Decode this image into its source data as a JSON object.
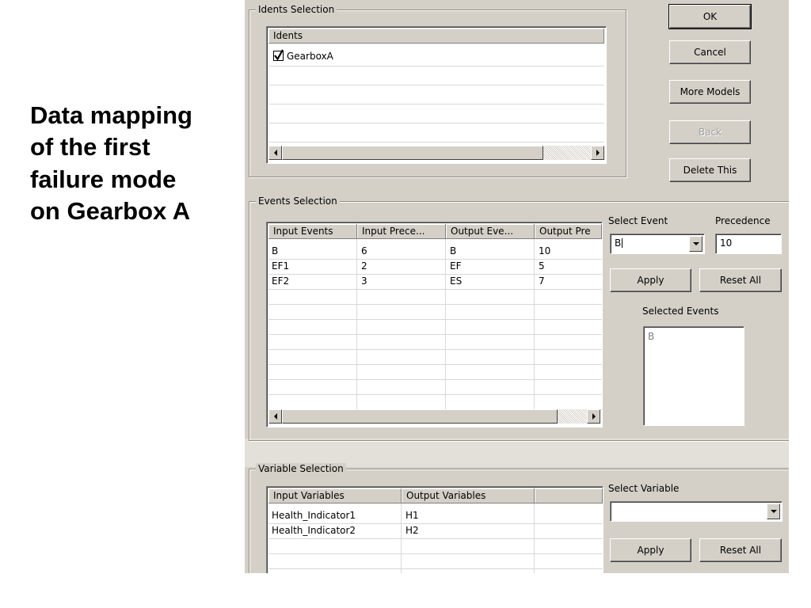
{
  "caption": {
    "lines": [
      "Data mapping",
      "of the first",
      "failure mode",
      "on Gearbox A"
    ]
  },
  "buttons": {
    "ok": "OK",
    "cancel": "Cancel",
    "more_models": "More Models",
    "back": "Back",
    "delete_this": "Delete This"
  },
  "idents": {
    "group_title": "Idents Selection",
    "column": "Idents",
    "items": [
      {
        "label": "GearboxA",
        "checked": true
      }
    ]
  },
  "events": {
    "group_title": "Events Selection",
    "columns": [
      "Input Events",
      "Input Prece...",
      "Output Eve...",
      "Output Pre"
    ],
    "rows": [
      [
        "B",
        "6",
        "B",
        "10"
      ],
      [
        "EF1",
        "2",
        "EF",
        "5"
      ],
      [
        "EF2",
        "3",
        "ES",
        "7"
      ]
    ],
    "select_event_label": "Select Event",
    "select_event_value": "B",
    "precedence_label": "Precedence",
    "precedence_value": "10",
    "apply": "Apply",
    "reset_all": "Reset All",
    "selected_events_label": "Selected Events",
    "selected_events": [
      "B"
    ]
  },
  "variables": {
    "group_title": "Variable Selection",
    "columns": [
      "Input Variables",
      "Output Variables",
      ""
    ],
    "rows": [
      [
        "Health_Indicator1",
        "H1",
        ""
      ],
      [
        "Health_Indicator2",
        "H2",
        ""
      ]
    ],
    "select_variable_label": "Select Variable",
    "select_variable_value": "",
    "apply": "Apply",
    "reset_all": "Reset All"
  }
}
